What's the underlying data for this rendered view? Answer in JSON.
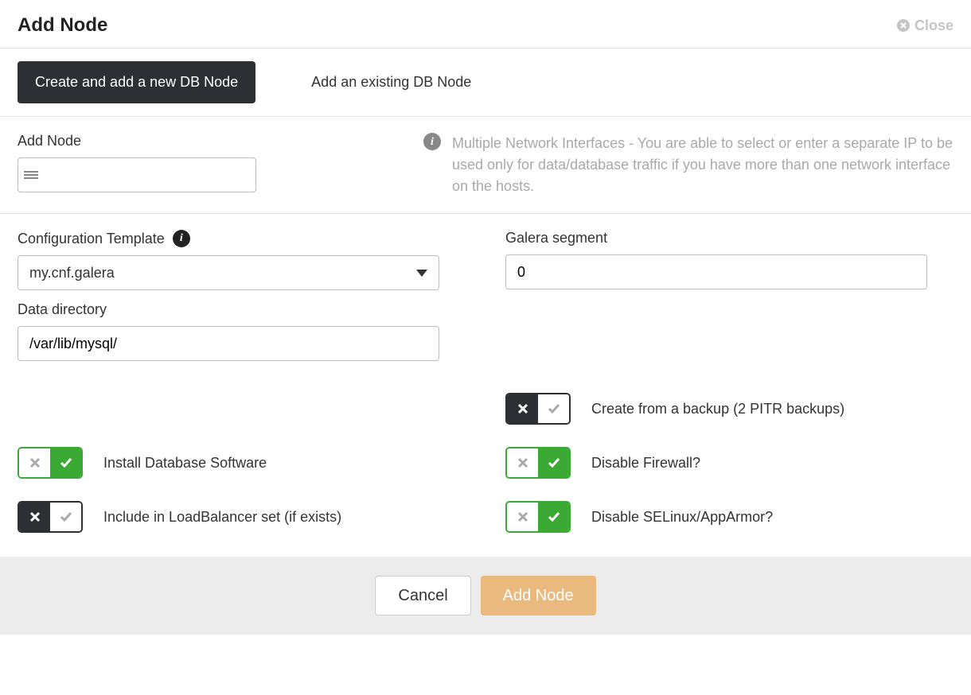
{
  "header": {
    "title": "Add Node",
    "close": "Close"
  },
  "tabs": {
    "create": "Create and add a new DB Node",
    "existing": "Add an existing DB Node"
  },
  "addNode": {
    "label": "Add Node",
    "help": "Multiple Network Interfaces - You are able to select or enter a separate IP to be used only for data/database traffic if you have more than one network interface on the hosts."
  },
  "config": {
    "templateLabel": "Configuration Template",
    "templateValue": "my.cnf.galera",
    "dataDirLabel": "Data directory",
    "dataDirValue": "/var/lib/mysql/",
    "galeraLabel": "Galera segment",
    "galeraValue": "0"
  },
  "toggles": {
    "backup": "Create from a backup (2 PITR backups)",
    "install": "Install Database Software",
    "firewall": "Disable Firewall?",
    "loadbalancer": "Include in LoadBalancer set (if exists)",
    "selinux": "Disable SELinux/AppArmor?"
  },
  "footer": {
    "cancel": "Cancel",
    "submit": "Add Node"
  }
}
